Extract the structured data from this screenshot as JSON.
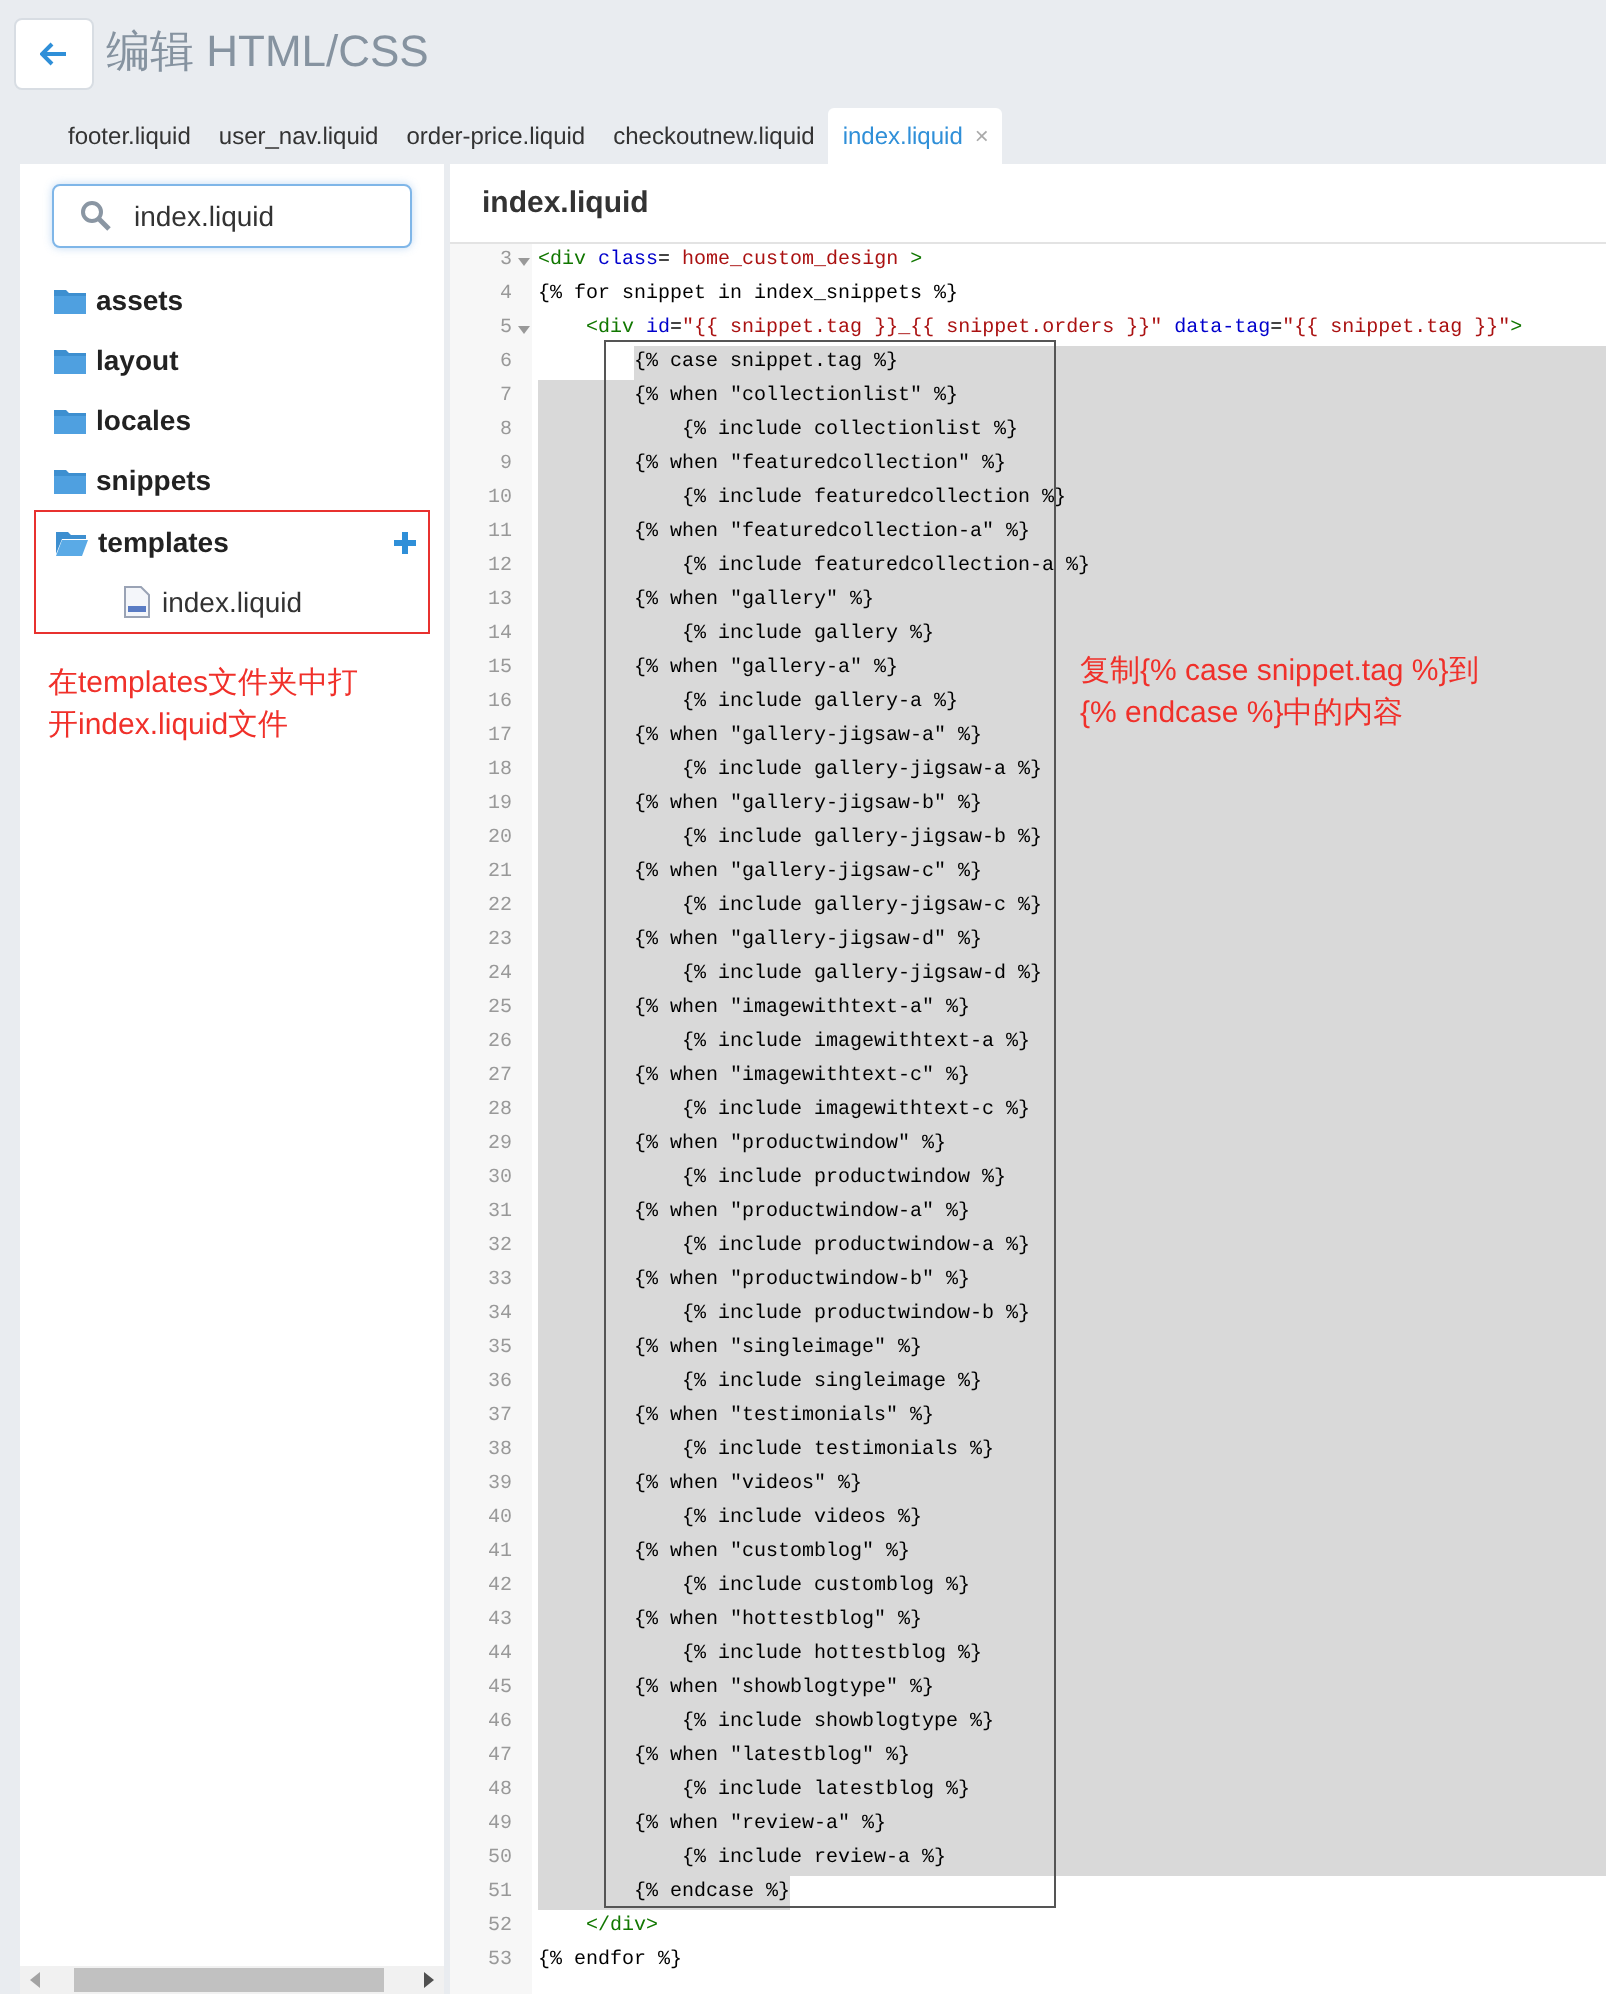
{
  "header": {
    "title": "编辑 HTML/CSS"
  },
  "tabs": [
    {
      "label": "footer.liquid",
      "selected": false
    },
    {
      "label": "user_nav.liquid",
      "selected": false
    },
    {
      "label": "order-price.liquid",
      "selected": false
    },
    {
      "label": "checkoutnew.liquid",
      "selected": false
    },
    {
      "label": "index.liquid",
      "selected": true,
      "close": "×"
    }
  ],
  "sidebar": {
    "search": {
      "value": "index.liquid"
    },
    "tree": [
      {
        "name": "assets",
        "expanded": false,
        "highlighted": false
      },
      {
        "name": "layout",
        "expanded": false,
        "highlighted": false
      },
      {
        "name": "locales",
        "expanded": false,
        "highlighted": false
      },
      {
        "name": "snippets",
        "expanded": false,
        "highlighted": false
      },
      {
        "name": "templates",
        "expanded": true,
        "highlighted": true,
        "children": [
          {
            "name": "index.liquid"
          }
        ]
      }
    ],
    "note": "在templates文件夹中打开index.liquid文件"
  },
  "editor": {
    "title": "index.liquid",
    "note": "复制{% case snippet.tag %}到{% endcase %}中的内容",
    "lines": [
      {
        "number": "3",
        "fold": true,
        "selected": false,
        "kind": "top",
        "segments": [
          {
            "text": "<div",
            "kind": "tag"
          },
          {
            "text": " class",
            "kind": "attr"
          },
          {
            "text": "=",
            "kind": "plain"
          },
          {
            "text": " home_custom_design ",
            "kind": "string"
          },
          {
            "text": ">",
            "kind": "tag"
          }
        ]
      },
      {
        "number": "4",
        "fold": false,
        "selected": false,
        "kind": "top",
        "text": "{% for snippet in index_snippets %}"
      },
      {
        "number": "5",
        "fold": true,
        "selected": false,
        "kind": "block",
        "segments": [
          {
            "text": "<div",
            "kind": "tag"
          },
          {
            "text": " id",
            "kind": "attr"
          },
          {
            "text": "=",
            "kind": "plain"
          },
          {
            "text": "\"{{ snippet.tag }}_{{ snippet.orders }}\"",
            "kind": "string"
          },
          {
            "text": " data-tag",
            "kind": "attr"
          },
          {
            "text": "=",
            "kind": "plain"
          },
          {
            "text": "\"{{ snippet.tag }}\"",
            "kind": "string"
          },
          {
            "text": ">",
            "kind": "tag"
          }
        ]
      },
      {
        "number": "6",
        "fold": false,
        "selected": true,
        "kind": "case",
        "text": "{% case snippet.tag %}"
      },
      {
        "number": "7",
        "fold": false,
        "selected": true,
        "kind": "case",
        "text": "{% when \"collectionlist\" %}"
      },
      {
        "number": "8",
        "fold": false,
        "selected": true,
        "kind": "include",
        "text": "{% include collectionlist %}"
      },
      {
        "number": "9",
        "fold": false,
        "selected": true,
        "kind": "case",
        "text": "{% when \"featuredcollection\" %}"
      },
      {
        "number": "10",
        "fold": false,
        "selected": true,
        "kind": "include",
        "text": "{% include featuredcollection %}"
      },
      {
        "number": "11",
        "fold": false,
        "selected": true,
        "kind": "case",
        "text": "{% when \"featuredcollection-a\" %}"
      },
      {
        "number": "12",
        "fold": false,
        "selected": true,
        "kind": "include",
        "text": "{% include featuredcollection-a %}"
      },
      {
        "number": "13",
        "fold": false,
        "selected": true,
        "kind": "case",
        "text": "{% when \"gallery\" %}"
      },
      {
        "number": "14",
        "fold": false,
        "selected": true,
        "kind": "include",
        "text": "{% include gallery %}"
      },
      {
        "number": "15",
        "fold": false,
        "selected": true,
        "kind": "case",
        "text": "{% when \"gallery-a\" %}"
      },
      {
        "number": "16",
        "fold": false,
        "selected": true,
        "kind": "include",
        "text": "{% include gallery-a %}"
      },
      {
        "number": "17",
        "fold": false,
        "selected": true,
        "kind": "case",
        "text": "{% when \"gallery-jigsaw-a\" %}"
      },
      {
        "number": "18",
        "fold": false,
        "selected": true,
        "kind": "include",
        "text": "{% include gallery-jigsaw-a %}"
      },
      {
        "number": "19",
        "fold": false,
        "selected": true,
        "kind": "case",
        "text": "{% when \"gallery-jigsaw-b\" %}"
      },
      {
        "number": "20",
        "fold": false,
        "selected": true,
        "kind": "include",
        "text": "{% include gallery-jigsaw-b %}"
      },
      {
        "number": "21",
        "fold": false,
        "selected": true,
        "kind": "case",
        "text": "{% when \"gallery-jigsaw-c\" %}"
      },
      {
        "number": "22",
        "fold": false,
        "selected": true,
        "kind": "include",
        "text": "{% include gallery-jigsaw-c %}"
      },
      {
        "number": "23",
        "fold": false,
        "selected": true,
        "kind": "case",
        "text": "{% when \"gallery-jigsaw-d\" %}"
      },
      {
        "number": "24",
        "fold": false,
        "selected": true,
        "kind": "include",
        "text": "{% include gallery-jigsaw-d %}"
      },
      {
        "number": "25",
        "fold": false,
        "selected": true,
        "kind": "case",
        "text": "{% when \"imagewithtext-a\" %}"
      },
      {
        "number": "26",
        "fold": false,
        "selected": true,
        "kind": "include",
        "text": "{% include imagewithtext-a %}"
      },
      {
        "number": "27",
        "fold": false,
        "selected": true,
        "kind": "case",
        "text": "{% when \"imagewithtext-c\" %}"
      },
      {
        "number": "28",
        "fold": false,
        "selected": true,
        "kind": "include",
        "text": "{% include imagewithtext-c %}"
      },
      {
        "number": "29",
        "fold": false,
        "selected": true,
        "kind": "case",
        "text": "{% when \"productwindow\" %}"
      },
      {
        "number": "30",
        "fold": false,
        "selected": true,
        "kind": "include",
        "text": "{% include productwindow %}"
      },
      {
        "number": "31",
        "fold": false,
        "selected": true,
        "kind": "case",
        "text": "{% when \"productwindow-a\" %}"
      },
      {
        "number": "32",
        "fold": false,
        "selected": true,
        "kind": "include",
        "text": "{% include productwindow-a %}"
      },
      {
        "number": "33",
        "fold": false,
        "selected": true,
        "kind": "case",
        "text": "{% when \"productwindow-b\" %}"
      },
      {
        "number": "34",
        "fold": false,
        "selected": true,
        "kind": "include",
        "text": "{% include productwindow-b %}"
      },
      {
        "number": "35",
        "fold": false,
        "selected": true,
        "kind": "case",
        "text": "{% when \"singleimage\" %}"
      },
      {
        "number": "36",
        "fold": false,
        "selected": true,
        "kind": "include",
        "text": "{% include singleimage %}"
      },
      {
        "number": "37",
        "fold": false,
        "selected": true,
        "kind": "case",
        "text": "{% when \"testimonials\" %}"
      },
      {
        "number": "38",
        "fold": false,
        "selected": true,
        "kind": "include",
        "text": "{% include testimonials %}"
      },
      {
        "number": "39",
        "fold": false,
        "selected": true,
        "kind": "case",
        "text": "{% when \"videos\" %}"
      },
      {
        "number": "40",
        "fold": false,
        "selected": true,
        "kind": "include",
        "text": "{% include videos %}"
      },
      {
        "number": "41",
        "fold": false,
        "selected": true,
        "kind": "case",
        "text": "{% when \"customblog\" %}"
      },
      {
        "number": "42",
        "fold": false,
        "selected": true,
        "kind": "include",
        "text": "{% include customblog %}"
      },
      {
        "number": "43",
        "fold": false,
        "selected": true,
        "kind": "case",
        "text": "{% when \"hottestblog\" %}"
      },
      {
        "number": "44",
        "fold": false,
        "selected": true,
        "kind": "include",
        "text": "{% include hottestblog %}"
      },
      {
        "number": "45",
        "fold": false,
        "selected": true,
        "kind": "case",
        "text": "{% when \"showblogtype\" %}"
      },
      {
        "number": "46",
        "fold": false,
        "selected": true,
        "kind": "include",
        "text": "{% include showblogtype %}"
      },
      {
        "number": "47",
        "fold": false,
        "selected": true,
        "kind": "case",
        "text": "{% when \"latestblog\" %}"
      },
      {
        "number": "48",
        "fold": false,
        "selected": true,
        "kind": "include",
        "text": "{% include latestblog %}"
      },
      {
        "number": "49",
        "fold": false,
        "selected": true,
        "kind": "case",
        "text": "{% when \"review-a\" %}"
      },
      {
        "number": "50",
        "fold": false,
        "selected": true,
        "kind": "include",
        "text": "{% include review-a %}"
      },
      {
        "number": "51",
        "fold": false,
        "selected": true,
        "kind": "case",
        "text": "{% endcase %}"
      },
      {
        "number": "52",
        "fold": false,
        "selected": false,
        "kind": "block",
        "segments": [
          {
            "text": "</div>",
            "kind": "tag"
          }
        ]
      },
      {
        "number": "53",
        "fold": false,
        "selected": false,
        "kind": "top",
        "text": "{% endfor %}"
      }
    ]
  }
}
